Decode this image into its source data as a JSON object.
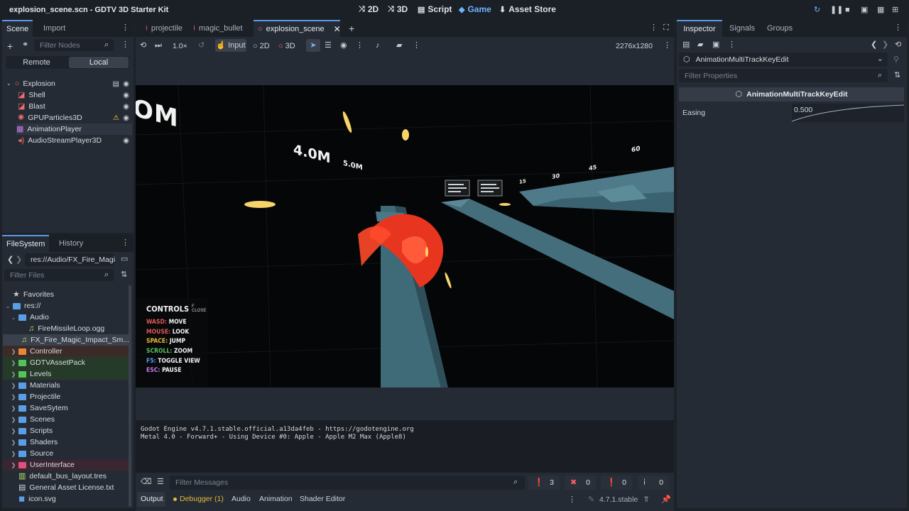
{
  "window": {
    "title": "explosion_scene.scn - GDTV 3D Starter Kit",
    "workspaces": [
      "2D",
      "3D",
      "Script",
      "Game",
      "Asset Store"
    ],
    "active_workspace": "Game"
  },
  "scene_dock": {
    "tabs": [
      "Scene",
      "Import"
    ],
    "filter_placeholder": "Filter Nodes",
    "remote_label": "Remote",
    "local_label": "Local",
    "nodes": [
      {
        "label": "Explosion",
        "icon": "node3d-icon",
        "color": "#f06a6a"
      },
      {
        "label": "Shell",
        "icon": "mesh-instance-icon",
        "color": "#f06a6a"
      },
      {
        "label": "Blast",
        "icon": "mesh-instance-icon",
        "color": "#f06a6a"
      },
      {
        "label": "GPUParticles3D",
        "icon": "particles-icon",
        "color": "#f06a6a"
      },
      {
        "label": "AnimationPlayer",
        "icon": "animation-player-icon",
        "color": "#c77be6"
      },
      {
        "label": "AudioStreamPlayer3D",
        "icon": "audio-player-icon",
        "color": "#f06a6a"
      }
    ]
  },
  "filesystem_dock": {
    "tabs": [
      "FileSystem",
      "History"
    ],
    "path": "res://Audio/FX_Fire_Magi",
    "filter_placeholder": "Filter Files",
    "favorites_label": "Favorites",
    "root_label": "res://",
    "items": [
      {
        "label": "Audio",
        "type": "folder-open",
        "depth": 1,
        "color": "#5b9ee8"
      },
      {
        "label": "FireMissileLoop.ogg",
        "type": "audio",
        "depth": 2
      },
      {
        "label": "FX_Fire_Magic_Impact_Sm...",
        "type": "audio",
        "depth": 2,
        "selected": true
      },
      {
        "label": "Controller",
        "type": "folder",
        "depth": 1,
        "color": "#e8873a",
        "tint": "#3a2b28"
      },
      {
        "label": "GDTVAssetPack",
        "type": "folder",
        "depth": 1,
        "color": "#56c25a",
        "tint": "#263a2a"
      },
      {
        "label": "Levels",
        "type": "folder",
        "depth": 1,
        "color": "#56c25a",
        "tint": "#263a2a"
      },
      {
        "label": "Materials",
        "type": "folder",
        "depth": 1,
        "color": "#5b9ee8"
      },
      {
        "label": "Projectile",
        "type": "folder",
        "depth": 1,
        "color": "#5b9ee8"
      },
      {
        "label": "SaveSytem",
        "type": "folder",
        "depth": 1,
        "color": "#5b9ee8"
      },
      {
        "label": "Scenes",
        "type": "folder",
        "depth": 1,
        "color": "#5b9ee8"
      },
      {
        "label": "Scripts",
        "type": "folder",
        "depth": 1,
        "color": "#5b9ee8"
      },
      {
        "label": "Shaders",
        "type": "folder",
        "depth": 1,
        "color": "#5b9ee8"
      },
      {
        "label": "Source",
        "type": "folder",
        "depth": 1,
        "color": "#5b9ee8"
      },
      {
        "label": "UserInterface",
        "type": "folder",
        "depth": 1,
        "color": "#e0507a",
        "tint": "#3a2630"
      },
      {
        "label": "default_bus_layout.tres",
        "type": "resource",
        "depth": 1
      },
      {
        "label": "General Asset License.txt",
        "type": "text",
        "depth": 1
      },
      {
        "label": "icon.svg",
        "type": "svg",
        "depth": 1
      }
    ]
  },
  "editor_tabs": [
    {
      "label": "projectile"
    },
    {
      "label": "magic_bullet"
    },
    {
      "label": "explosion_scene",
      "active": true
    }
  ],
  "game_toolbar": {
    "speed": "1.0×",
    "input_label": "Input",
    "mode_2d": "2D",
    "mode_3d": "3D",
    "resolution": "2276x1280"
  },
  "game_view": {
    "hud_texts": [
      "4.0M",
      "5.0M",
      "15",
      "30",
      "45",
      "60"
    ],
    "controls": {
      "title": "CONTROLS",
      "close_hint": "F CLOSE",
      "rows": [
        {
          "key": "WASD:",
          "action": "MOVE",
          "color": "#e25656"
        },
        {
          "key": "MOUSE:",
          "action": "LOOK",
          "color": "#e25656"
        },
        {
          "key": "SPACE:",
          "action": "JUMP",
          "color": "#e6b93a"
        },
        {
          "key": "SCROLL:",
          "action": "ZOOM",
          "color": "#56c25a"
        },
        {
          "key": "F5:",
          "action": "TOGGLE VIEW",
          "color": "#5b9ee8"
        },
        {
          "key": "ESC:",
          "action": "PAUSE",
          "color": "#c77be6"
        }
      ]
    }
  },
  "output_panel": {
    "lines": [
      "Godot Engine v4.7.1.stable.official.a13da4feb - https://godotengine.org",
      "Metal 4.0 - Forward+ - Using Device #0: Apple - Apple M2 Max (Apple8)"
    ],
    "filter_placeholder": "Filter Messages",
    "counts": {
      "messages": "3",
      "errors": "0",
      "warnings": "0",
      "info": "0"
    }
  },
  "bottom_tabs": [
    "Output",
    "Debugger (1)",
    "Audio",
    "Animation",
    "Shader Editor"
  ],
  "version": "4.7.1.stable",
  "inspector": {
    "tabs": [
      "Inspector",
      "Signals",
      "Groups"
    ],
    "object_name": "AnimationMultiTrackKeyEdit",
    "filter_placeholder": "Filter Properties",
    "section_title": "AnimationMultiTrackKeyEdit",
    "property_label": "Easing",
    "property_value": "0.500"
  }
}
